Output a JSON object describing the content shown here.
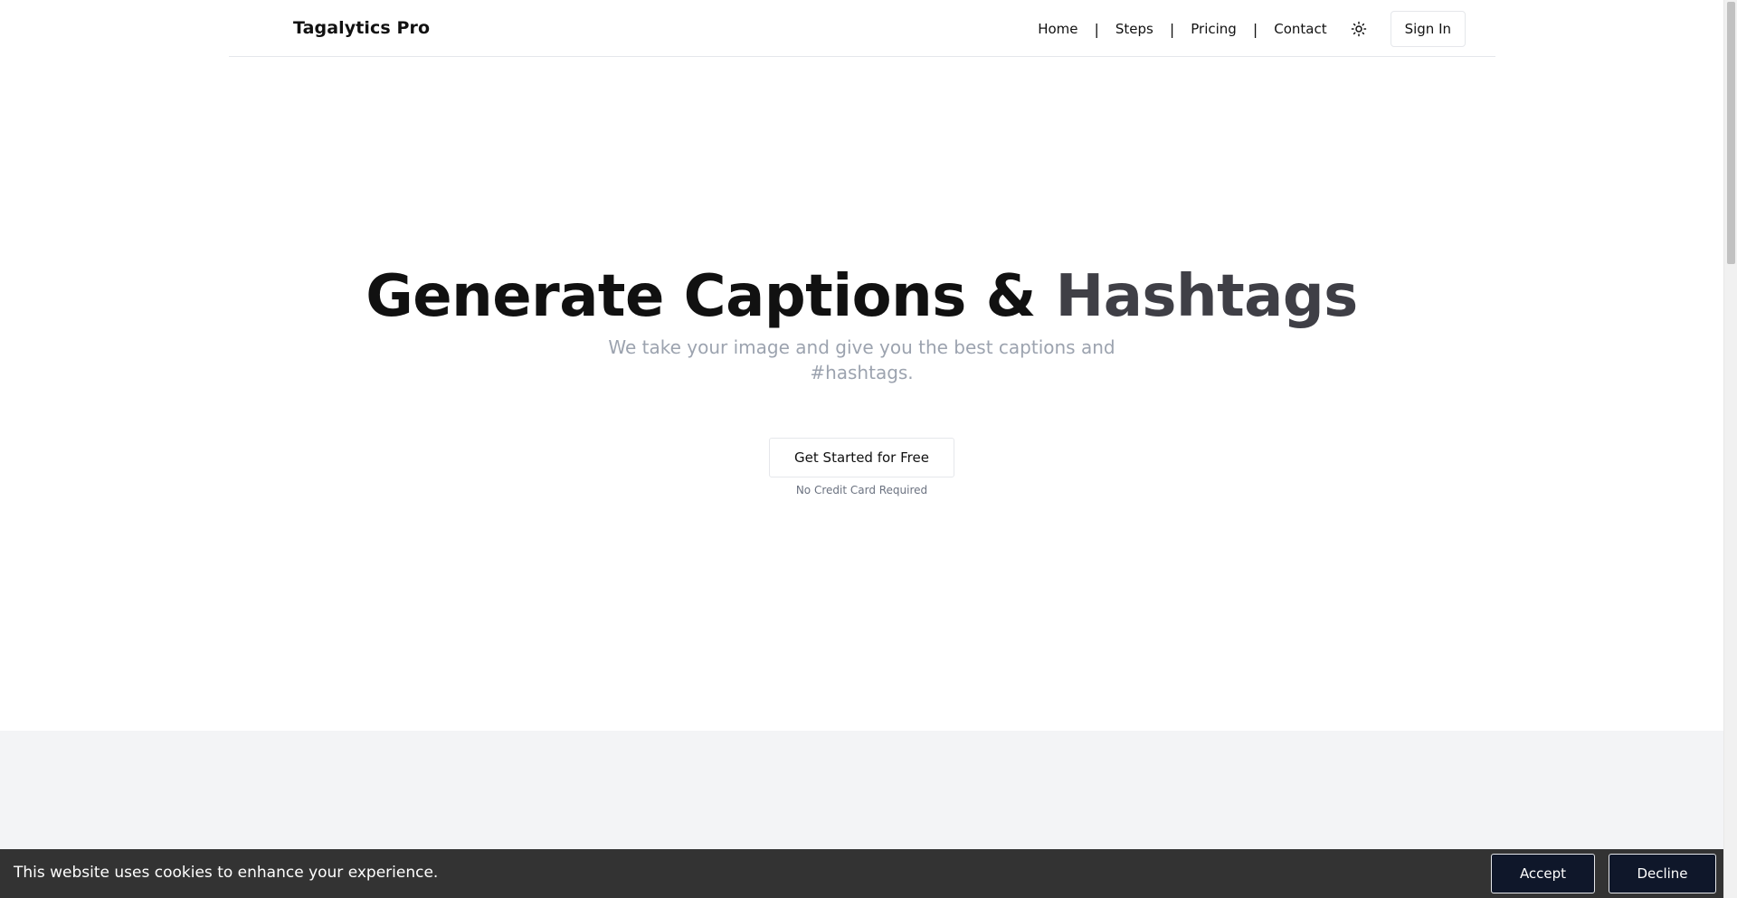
{
  "header": {
    "brand": "Tagalytics Pro",
    "nav": {
      "home": "Home",
      "steps": "Steps",
      "pricing": "Pricing",
      "contact": "Contact",
      "separator": "|"
    },
    "theme_icon": "sun-icon",
    "sign_in": "Sign In"
  },
  "hero": {
    "title_part1": "Generate Captions & ",
    "title_part2": "Hashtags",
    "subtitle": "We take your image and give you the best captions and #hashtags.",
    "cta": "Get Started for Free",
    "cta_note": "No Credit Card Required"
  },
  "cookie_banner": {
    "message": "This website uses cookies to enhance your experience.",
    "accept": "Accept",
    "decline": "Decline"
  },
  "colors": {
    "title_primary": "#111111",
    "title_accent": "#3f3f46",
    "subtitle": "#9ca3af",
    "cookie_bg": "#333333",
    "cookie_button": "#0f172a",
    "section_gray": "#f3f4f6"
  }
}
